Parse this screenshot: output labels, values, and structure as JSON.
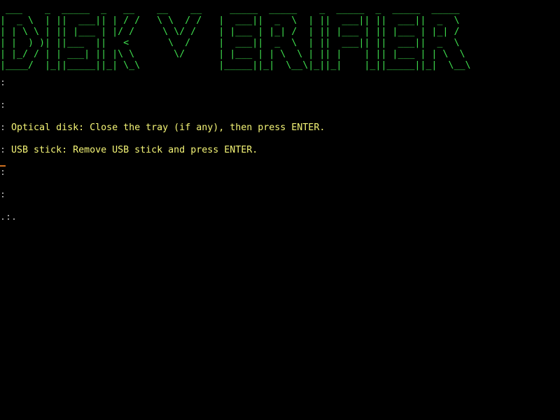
{
  "colors": {
    "background": "#000000",
    "banner": "#3fe04f",
    "message": "#f4f476",
    "prompt": "#b8b8b8",
    "cursor": "#d07020"
  },
  "banner": {
    "text": " ___    _  _____  _   __    __    __     _____  _____    _  _____  _  _____  _____\n|  _ \\  | ||  ___|| | / /   \\ \\  / /   |  ___||  _  \\  | ||  ___|| ||  ___||  _  \\\n| | \\ \\ | || |___ | |/ /     \\ \\/ /    | |___ | |_| /  | || |___ | || |___ | |_| /\n| |  ) )| ||___  ||   <       \\  /     |  ___||  _  \\  | ||  ___|| ||  ___||  _  \\\n| |_/ / | | ___| || |\\ \\       \\/      | |___ | | \\  \\ | || |    | || |___ | | \\  \\\n|____/  |_||_____||_| \\_\\              |_____||_|  \\__\\|_||_|    |_||_____||_|  \\__\\"
  },
  "console": {
    "lines": [
      {
        "prefix": ":",
        "text": ""
      },
      {
        "prefix": ":",
        "text": ""
      },
      {
        "prefix": ":",
        "text": " Optical disk: Close the tray (if any), then press ENTER."
      },
      {
        "prefix": ":",
        "text": " USB stick: Remove USB stick and press ENTER."
      },
      {
        "prefix": ":",
        "text": ""
      },
      {
        "prefix": ":",
        "text": ""
      },
      {
        "prefix": ".:.",
        "text": ""
      }
    ]
  }
}
